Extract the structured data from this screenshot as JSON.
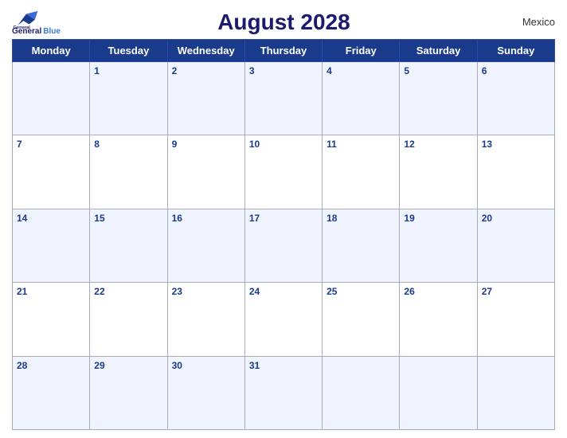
{
  "header": {
    "title": "August 2028",
    "country": "Mexico",
    "logo_line1": "General",
    "logo_line2": "Blue"
  },
  "weekdays": [
    "Monday",
    "Tuesday",
    "Wednesday",
    "Thursday",
    "Friday",
    "Saturday",
    "Sunday"
  ],
  "weeks": [
    [
      null,
      1,
      2,
      3,
      4,
      5,
      6
    ],
    [
      7,
      8,
      9,
      10,
      11,
      12,
      13
    ],
    [
      14,
      15,
      16,
      17,
      18,
      19,
      20
    ],
    [
      21,
      22,
      23,
      24,
      25,
      26,
      27
    ],
    [
      28,
      29,
      30,
      31,
      null,
      null,
      null
    ]
  ]
}
